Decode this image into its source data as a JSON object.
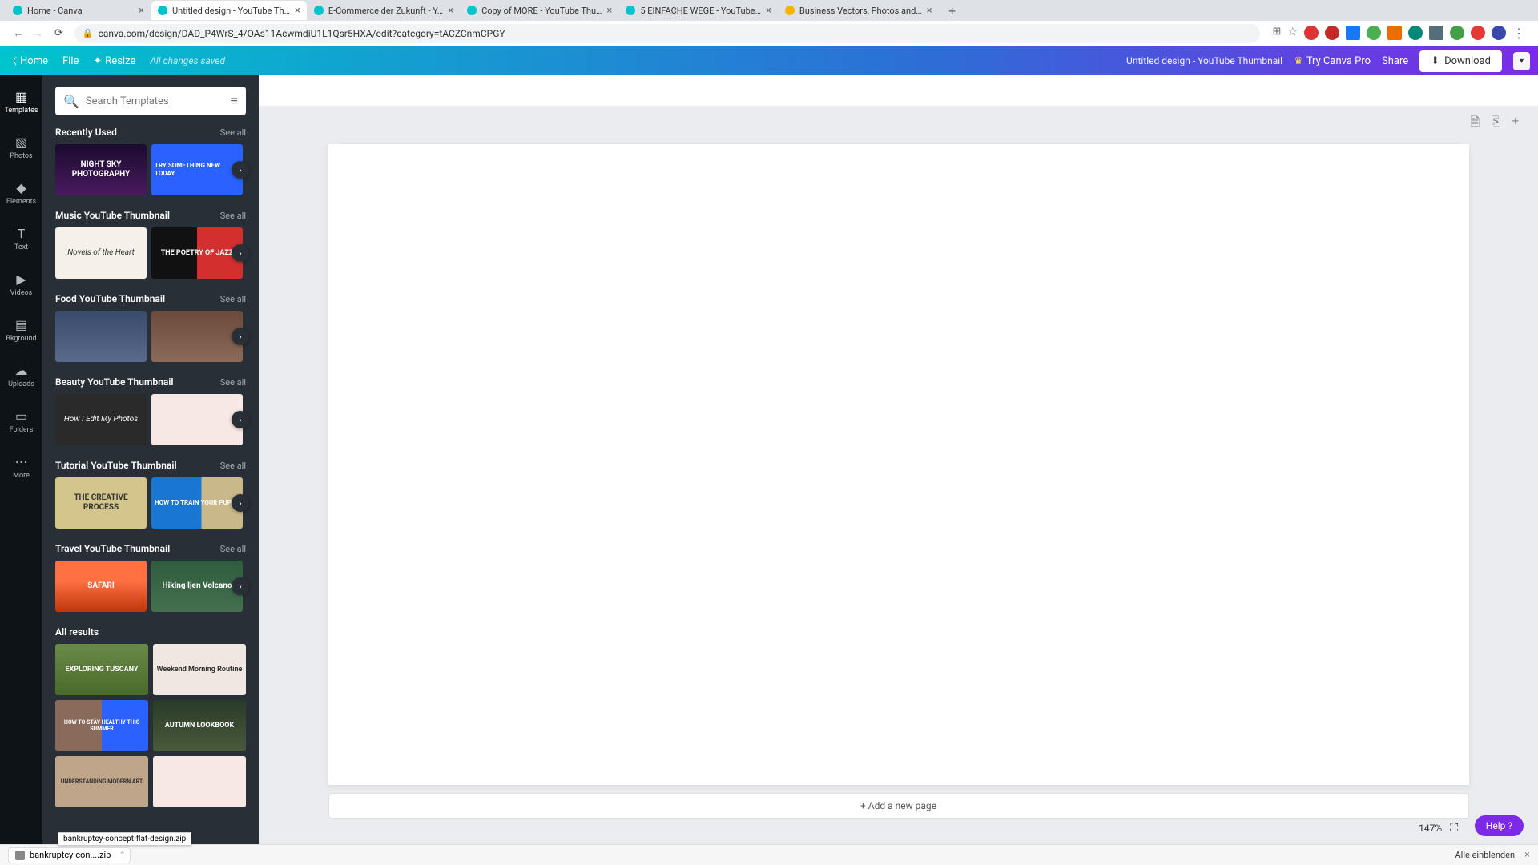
{
  "browser": {
    "tabs": [
      {
        "title": "Home - Canva"
      },
      {
        "title": "Untitled design - YouTube Th…"
      },
      {
        "title": "E-Commerce der Zukunft - Y…"
      },
      {
        "title": "Copy of MORE - YouTube Thu…"
      },
      {
        "title": "5 EINFACHE WEGE - YouTube…"
      },
      {
        "title": "Business Vectors, Photos and…"
      }
    ],
    "url": "canva.com/design/DAD_P4WrS_4/OAs11AcwmdiU1L1Qsr5HXA/edit?category=tACZCnmCPGY"
  },
  "appbar": {
    "home": "Home",
    "file": "File",
    "resize": "Resize",
    "saved": "All changes saved",
    "title": "Untitled design - YouTube Thumbnail",
    "try_pro": "Try Canva Pro",
    "share": "Share",
    "download": "Download"
  },
  "rail": {
    "items": [
      {
        "label": "Templates"
      },
      {
        "label": "Photos"
      },
      {
        "label": "Elements"
      },
      {
        "label": "Text"
      },
      {
        "label": "Videos"
      },
      {
        "label": "Bkground"
      },
      {
        "label": "Uploads"
      },
      {
        "label": "Folders"
      },
      {
        "label": "More"
      }
    ]
  },
  "search": {
    "placeholder": "Search Templates"
  },
  "sections": {
    "see_all": "See all",
    "recently_used": {
      "title": "Recently Used",
      "t1": "NIGHT SKY PHOTOGRAPHY",
      "t2": "TRY SOMETHING NEW TODAY"
    },
    "music": {
      "title": "Music YouTube Thumbnail",
      "t1": "Novels of the Heart",
      "t2": "THE POETRY OF JAZZ"
    },
    "food": {
      "title": "Food YouTube Thumbnail"
    },
    "beauty": {
      "title": "Beauty YouTube Thumbnail",
      "t1": "How I Edit My Photos"
    },
    "tutorial": {
      "title": "Tutorial YouTube Thumbnail",
      "t1": "THE CREATIVE PROCESS",
      "t2": "HOW TO TRAIN YOUR PUPPY"
    },
    "travel": {
      "title": "Travel YouTube Thumbnail",
      "t1": "SAFARI",
      "t2": "Hiking Ijen Volcano"
    },
    "all": {
      "title": "All results",
      "g1": "EXPLORING TUSCANY",
      "g2": "Weekend Morning Routine",
      "g3": "HOW TO STAY HEALTHY THIS SUMMER",
      "g4": "AUTUMN LOOKBOOK",
      "g5": "UNDERSTANDING MODERN ART",
      "g6": ""
    }
  },
  "canvas": {
    "add_page": "+ Add a new page",
    "zoom": "147%",
    "help": "Help ?"
  },
  "download_bar": {
    "file": "bankruptcy-con....zip",
    "tooltip": "bankruptcy-concept-flat-design.zip",
    "show_all": "Alle einblenden"
  }
}
